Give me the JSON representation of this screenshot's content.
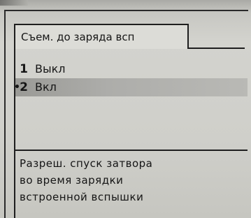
{
  "menu": {
    "title": "Съем. до заряда всп"
  },
  "options": [
    {
      "number": "1",
      "label": "Выкл",
      "selected": false
    },
    {
      "number": "2",
      "label": "Вкл",
      "selected": true,
      "marker": "•"
    }
  ],
  "help": {
    "lines": [
      "Разреш. спуск затвора",
      "во время зарядки",
      "встроенной вспышки"
    ]
  }
}
